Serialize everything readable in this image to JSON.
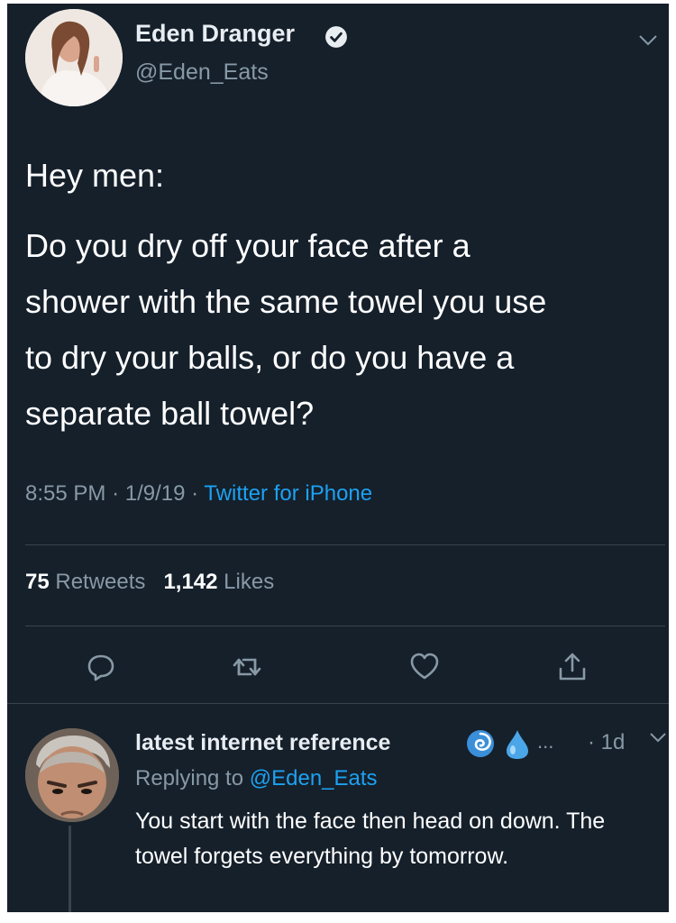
{
  "tweet": {
    "author_name": "Eden Dranger",
    "author_handle": "@Eden_Eats",
    "verified": true,
    "intro": "Hey men:",
    "body_lines": [
      "Do you dry off your face after a",
      "shower with the same towel you use",
      "to dry your balls, or do you have a",
      "separate ball towel?"
    ],
    "time": "8:55 PM",
    "date": "1/9/19",
    "source": "Twitter for iPhone",
    "retweet_count": "75",
    "retweets_label": "Retweets",
    "like_count": "1,142",
    "likes_label": "Likes"
  },
  "actions": {
    "reply_icon": "reply-bubble-icon",
    "retweet_icon": "retweet-icon",
    "like_icon": "heart-icon",
    "share_icon": "share-icon"
  },
  "reply": {
    "author_name": "latest internet reference",
    "emoji": [
      "cyclone",
      "droplet"
    ],
    "overflow": "...",
    "age": "· 1d",
    "replying_prefix": "Replying to",
    "replying_to": "@Eden_Eats",
    "text": "You start with the face then head on down. The towel forgets everything by tomorrow."
  },
  "colors": {
    "background": "#15202b",
    "link": "#1da1f2",
    "secondary_text": "#8899a6",
    "divider": "#38444d"
  }
}
